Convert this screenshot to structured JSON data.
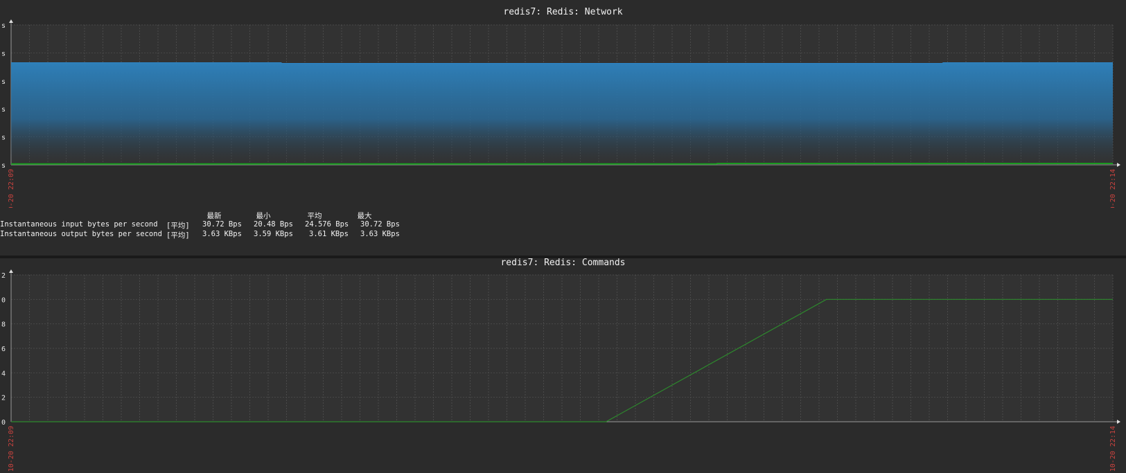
{
  "chart_data": [
    {
      "type": "area",
      "title": "redis7: Redis: Network",
      "x_labels": [
        "10-20 22:09",
        "10-20 22:14"
      ],
      "y_tick_labels": [
        "s",
        "s",
        "s",
        "s",
        "s",
        "s"
      ],
      "grid": true,
      "legend": {
        "headers": [
          "最新",
          "最小",
          "平均",
          "最大"
        ],
        "rows": [
          {
            "name": "Instantaneous input bytes per second",
            "func": "[平均]",
            "last": "30.72 Bps",
            "min": "20.48 Bps",
            "avg": "24.576 Bps",
            "max": "30.72 Bps"
          },
          {
            "name": "Instantaneous output bytes per second",
            "func": "[平均]",
            "last": "3.63 KBps",
            "min": "3.59 KBps",
            "avg": "3.61 KBps",
            "max": "3.63 KBps"
          }
        ]
      },
      "series": [
        {
          "name": "Instantaneous output bytes per second",
          "color": "#2e7fb8",
          "x": [
            0,
            0.245,
            0.246,
            0.845,
            0.846,
            1
          ],
          "values": [
            0.73,
            0.73,
            0.725,
            0.725,
            0.73,
            0.73
          ]
        },
        {
          "name": "Instantaneous input bytes per second",
          "color": "#19a01f",
          "x": [
            0,
            0.64,
            0.641,
            1
          ],
          "values": [
            0.006,
            0.006,
            0.009,
            0.009
          ]
        }
      ]
    },
    {
      "type": "line",
      "title": "redis7: Redis: Commands",
      "x_labels": [
        "10-20 22:09",
        "10-20 22:14"
      ],
      "y_tick_labels": [
        "0",
        "2",
        "4",
        "6",
        "8",
        "0",
        "2"
      ],
      "grid": true,
      "series": [
        {
          "color": "#2d8a2d",
          "x": [
            0,
            0.54,
            0.74,
            1
          ],
          "values": [
            0,
            0,
            10,
            10
          ]
        }
      ]
    }
  ]
}
